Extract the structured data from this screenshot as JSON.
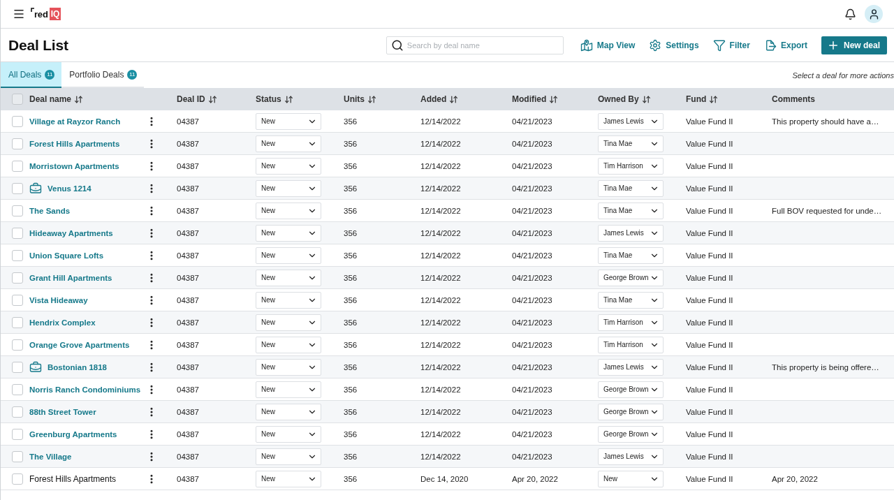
{
  "header": {
    "logo": {
      "word": "red",
      "tile": "IQ"
    }
  },
  "page": {
    "title": "Deal List",
    "search": {
      "placeholder": "Search by deal name"
    },
    "actions": [
      {
        "label": "Map View",
        "kind": "map"
      },
      {
        "label": "Settings",
        "kind": "settings"
      },
      {
        "label": "Filter",
        "kind": "filter"
      },
      {
        "label": "Export",
        "kind": "export"
      }
    ],
    "primary_action": "New deal"
  },
  "tabs": [
    {
      "label": "All Deals",
      "count": "11",
      "selected": true
    },
    {
      "label": "Portfolio Deals",
      "count": "11",
      "selected": false
    }
  ],
  "hint": "Select a deal for more actions",
  "table": {
    "all_checked": false,
    "columns": [
      {
        "label": "Deal name",
        "sortable": true
      },
      {
        "label": "Deal ID",
        "sortable": true
      },
      {
        "label": "Status",
        "sortable": true
      },
      {
        "label": "Units",
        "sortable": true
      },
      {
        "label": "Added",
        "sortable": true
      },
      {
        "label": "Modified",
        "sortable": true
      },
      {
        "label": "Owned By",
        "sortable": true
      },
      {
        "label": "Fund",
        "sortable": true
      },
      {
        "label": "Comments",
        "sortable": false
      }
    ],
    "rows": [
      {
        "name": "Village at Rayzor Ranch",
        "linked": true,
        "portfolio": false,
        "checked": false,
        "deal_id": "04387",
        "status": "New",
        "units": "356",
        "added": "12/14/2022",
        "modified": "04/21/2023",
        "owner": "James Lewis",
        "fund": "Value Fund II",
        "comments": "This property should have a…"
      },
      {
        "name": "Forest Hills Apartments",
        "linked": true,
        "portfolio": false,
        "checked": false,
        "deal_id": "04387",
        "status": "New",
        "units": "356",
        "added": "12/14/2022",
        "modified": "04/21/2023",
        "owner": "Tina Mae",
        "fund": "Value Fund II"
      },
      {
        "name": "Morristown Apartments",
        "linked": true,
        "portfolio": false,
        "checked": false,
        "deal_id": "04387",
        "status": "New",
        "units": "356",
        "added": "12/14/2022",
        "modified": "04/21/2023",
        "owner": "Tim Harrison",
        "fund": "Value Fund II"
      },
      {
        "name": "Venus 1214",
        "linked": true,
        "portfolio": true,
        "checked": false,
        "deal_id": "04387",
        "status": "New",
        "units": "356",
        "added": "12/14/2022",
        "modified": "04/21/2023",
        "owner": "Tina Mae",
        "fund": "Value Fund II"
      },
      {
        "name": "The Sands",
        "linked": true,
        "portfolio": false,
        "checked": false,
        "deal_id": "04387",
        "status": "New",
        "units": "356",
        "added": "12/14/2022",
        "modified": "04/21/2023",
        "owner": "Tina Mae",
        "fund": "Value Fund II",
        "comments": "Full BOV requested for unde…"
      },
      {
        "name": "Hideaway Apartments",
        "linked": true,
        "portfolio": false,
        "checked": false,
        "deal_id": "04387",
        "status": "New",
        "units": "356",
        "added": "12/14/2022",
        "modified": "04/21/2023",
        "owner": "James Lewis",
        "fund": "Value Fund II"
      },
      {
        "name": "Union Square Lofts",
        "linked": true,
        "portfolio": false,
        "checked": false,
        "deal_id": "04387",
        "status": "New",
        "units": "356",
        "added": "12/14/2022",
        "modified": "04/21/2023",
        "owner": "Tina Mae",
        "fund": "Value Fund II"
      },
      {
        "name": "Grant Hill Apartments",
        "linked": true,
        "portfolio": false,
        "checked": false,
        "deal_id": "04387",
        "status": "New",
        "units": "356",
        "added": "12/14/2022",
        "modified": "04/21/2023",
        "owner": "George Brown",
        "fund": "Value Fund II"
      },
      {
        "name": "Vista Hideaway",
        "linked": true,
        "portfolio": false,
        "checked": false,
        "deal_id": "04387",
        "status": "New",
        "units": "356",
        "added": "12/14/2022",
        "modified": "04/21/2023",
        "owner": "Tina Mae",
        "fund": "Value Fund II"
      },
      {
        "name": "Hendrix Complex",
        "linked": true,
        "portfolio": false,
        "checked": false,
        "deal_id": "04387",
        "status": "New",
        "units": "356",
        "added": "12/14/2022",
        "modified": "04/21/2023",
        "owner": "Tim Harrison",
        "fund": "Value Fund II"
      },
      {
        "name": "Orange Grove Apartments",
        "linked": true,
        "portfolio": false,
        "checked": false,
        "deal_id": "04387",
        "status": "New",
        "units": "356",
        "added": "12/14/2022",
        "modified": "04/21/2023",
        "owner": "Tim Harrison",
        "fund": "Value Fund II"
      },
      {
        "name": "Bostonian 1818",
        "linked": true,
        "portfolio": true,
        "checked": false,
        "deal_id": "04387",
        "status": "New",
        "units": "356",
        "added": "12/14/2022",
        "modified": "04/21/2023",
        "owner": "James Lewis",
        "fund": "Value Fund II",
        "comments": "This property is being offere…"
      },
      {
        "name": "Norris Ranch Condominiums",
        "linked": true,
        "portfolio": false,
        "checked": false,
        "deal_id": "04387",
        "status": "New",
        "units": "356",
        "added": "12/14/2022",
        "modified": "04/21/2023",
        "owner": "George Brown",
        "fund": "Value Fund II"
      },
      {
        "name": "88th Street Tower",
        "linked": true,
        "portfolio": false,
        "checked": false,
        "deal_id": "04387",
        "status": "New",
        "units": "356",
        "added": "12/14/2022",
        "modified": "04/21/2023",
        "owner": "George Brown",
        "fund": "Value Fund II"
      },
      {
        "name": "Greenburg Apartments",
        "linked": true,
        "portfolio": false,
        "checked": false,
        "deal_id": "04387",
        "status": "New",
        "units": "356",
        "added": "12/14/2022",
        "modified": "04/21/2023",
        "owner": "George Brown",
        "fund": "Value Fund II"
      },
      {
        "name": "The Village",
        "linked": true,
        "portfolio": false,
        "checked": false,
        "deal_id": "04387",
        "status": "New",
        "units": "356",
        "added": "12/14/2022",
        "modified": "04/21/2023",
        "owner": "James Lewis",
        "fund": "Value Fund II"
      },
      {
        "name": "Forest Hills Apartments",
        "linked": false,
        "portfolio": false,
        "checked": false,
        "deal_id": "04387",
        "status": "New",
        "units": "356",
        "added": "Dec 14, 2020",
        "modified": "Apr 20, 2022",
        "owner": "New",
        "fund": "Value Fund II",
        "comments": "Apr 20, 2022"
      }
    ]
  }
}
